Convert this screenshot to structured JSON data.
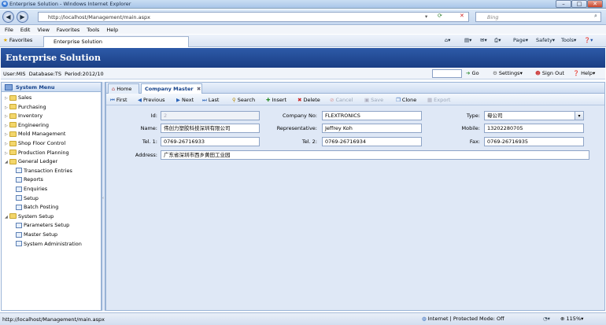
{
  "window": {
    "title": "Enterprise Solution - Windows Internet Explorer"
  },
  "browser": {
    "url": "http://localhost/Management/main.aspx",
    "search_placeholder": "Bing",
    "menu": [
      "File",
      "Edit",
      "View",
      "Favorites",
      "Tools",
      "Help"
    ],
    "favorites_label": "Favorites",
    "tab_title": "Enterprise Solution",
    "tools": [
      "Page",
      "Safety",
      "Tools"
    ]
  },
  "app": {
    "title": "Enterprise Solution",
    "user": "User:MIS",
    "database": "Database:TS",
    "period": "Period:2012/10",
    "go_label": "Go",
    "settings_label": "Settings",
    "signout_label": "Sign Out",
    "help_label": "Help"
  },
  "sidebar": {
    "header": "System Menu",
    "items": [
      {
        "label": "Sales",
        "type": "folder"
      },
      {
        "label": "Purchasing",
        "type": "folder"
      },
      {
        "label": "Inventory",
        "type": "folder"
      },
      {
        "label": "Engineering",
        "type": "folder"
      },
      {
        "label": "Mold Management",
        "type": "folder"
      },
      {
        "label": "Shop Floor Control",
        "type": "folder"
      },
      {
        "label": "Production Planning",
        "type": "folder"
      },
      {
        "label": "General Ledger",
        "type": "folder-open"
      },
      {
        "label": "Transaction Entries",
        "type": "doc"
      },
      {
        "label": "Reports",
        "type": "doc"
      },
      {
        "label": "Enquiries",
        "type": "doc"
      },
      {
        "label": "Setup",
        "type": "doc"
      },
      {
        "label": "Batch Posting",
        "type": "doc"
      },
      {
        "label": "System Setup",
        "type": "folder-open"
      },
      {
        "label": "Parameters Setup",
        "type": "doc"
      },
      {
        "label": "Master Setup",
        "type": "doc"
      },
      {
        "label": "System Administration",
        "type": "doc"
      }
    ]
  },
  "tabs": {
    "home": "Home",
    "active": "Company Master"
  },
  "toolbar": {
    "first": "First",
    "previous": "Previous",
    "next": "Next",
    "last": "Last",
    "search": "Search",
    "insert": "Insert",
    "delete": "Delete",
    "cancel": "Cancel",
    "save": "Save",
    "clone": "Clone",
    "export": "Export"
  },
  "form": {
    "id_label": "Id:",
    "id_value": "2",
    "company_no_label": "Company No:",
    "company_no_value": "FLEXTRONICS",
    "type_label": "Type:",
    "type_value": "母公司",
    "name_label": "Name:",
    "name_value": "伟创力塑胶科技深圳有限公司",
    "representative_label": "Representative:",
    "representative_value": "Jeffrey Koh",
    "mobile_label": "Mobile:",
    "mobile_value": "13202280705",
    "tel1_label": "Tel. 1:",
    "tel1_value": "0769-26716933",
    "tel2_label": "Tel. 2:",
    "tel2_value": "0769-26716934",
    "fax_label": "Fax:",
    "fax_value": "0769-26716935",
    "address_label": "Address:",
    "address_value": "广东省深圳市西乡黄田工业园"
  },
  "status": {
    "url": "http://localhost/Management/main.aspx",
    "zone": "Internet | Protected Mode: Off",
    "zoom": "115%"
  }
}
